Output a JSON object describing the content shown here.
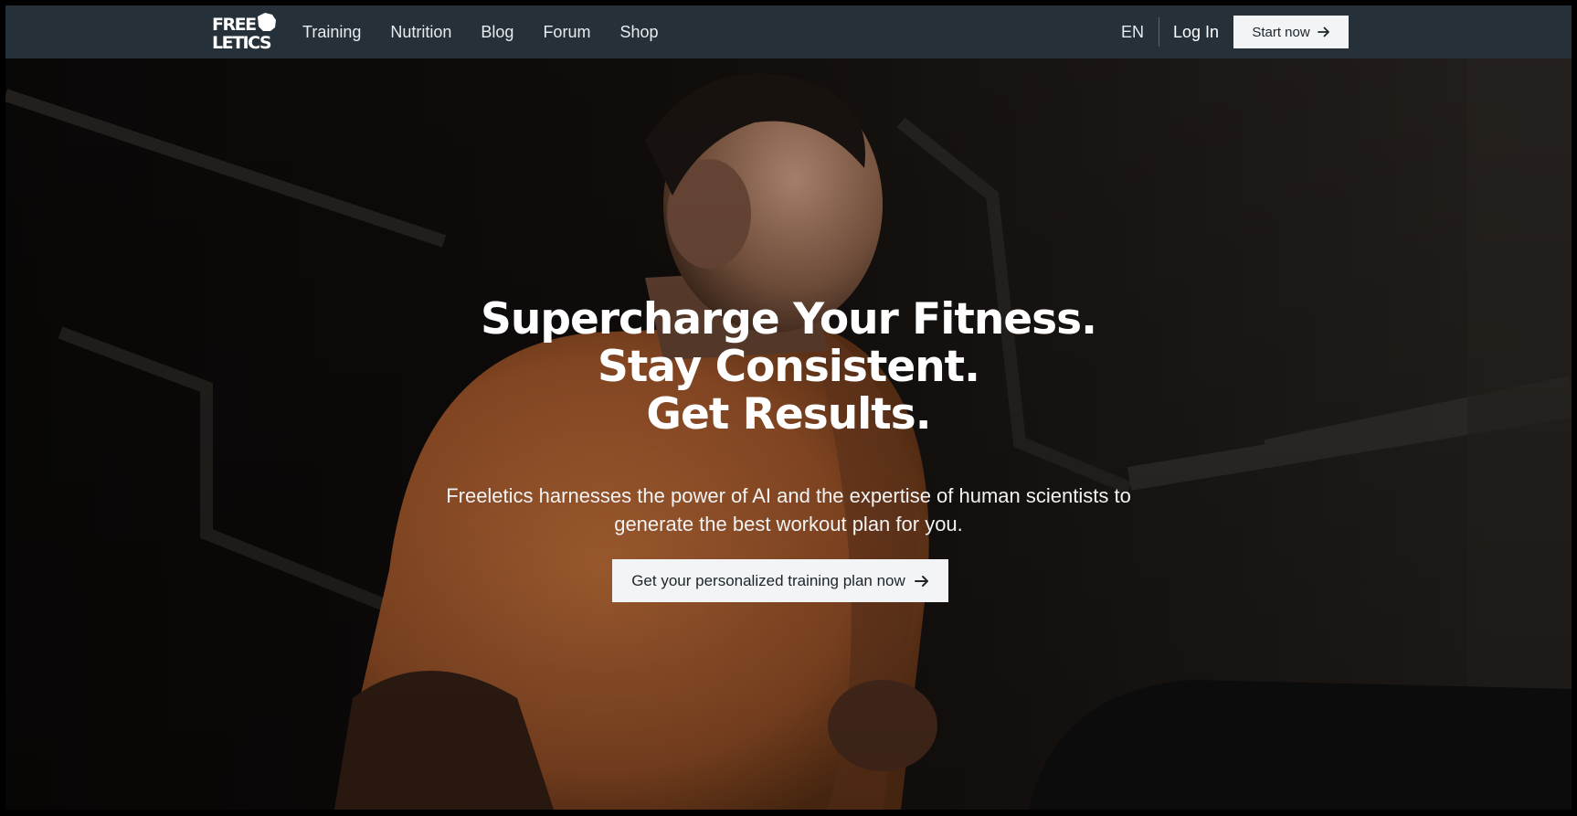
{
  "brand": {
    "logo_text_line1": "FREE",
    "logo_text_line2": "LETICS",
    "logo_icon": "fist-icon"
  },
  "nav": {
    "links": [
      "Training",
      "Nutrition",
      "Blog",
      "Forum",
      "Shop"
    ],
    "language": "EN",
    "login_label": "Log In",
    "start_label": "Start now",
    "start_icon": "arrow-right-icon"
  },
  "hero": {
    "headline_lines": [
      "Supercharge Your Fitness.",
      "Stay Consistent.",
      "Get Results."
    ],
    "subline": "Freeletics harnesses the power of AI and the expertise of human scientists to generate the best workout plan for you.",
    "cta_label": "Get your personalized training plan now",
    "cta_icon": "arrow-right-icon"
  },
  "colors": {
    "navbar": "#263038",
    "button_bg": "#f2f4f5",
    "button_text": "#1d252b",
    "shirt": "#c8703a"
  }
}
